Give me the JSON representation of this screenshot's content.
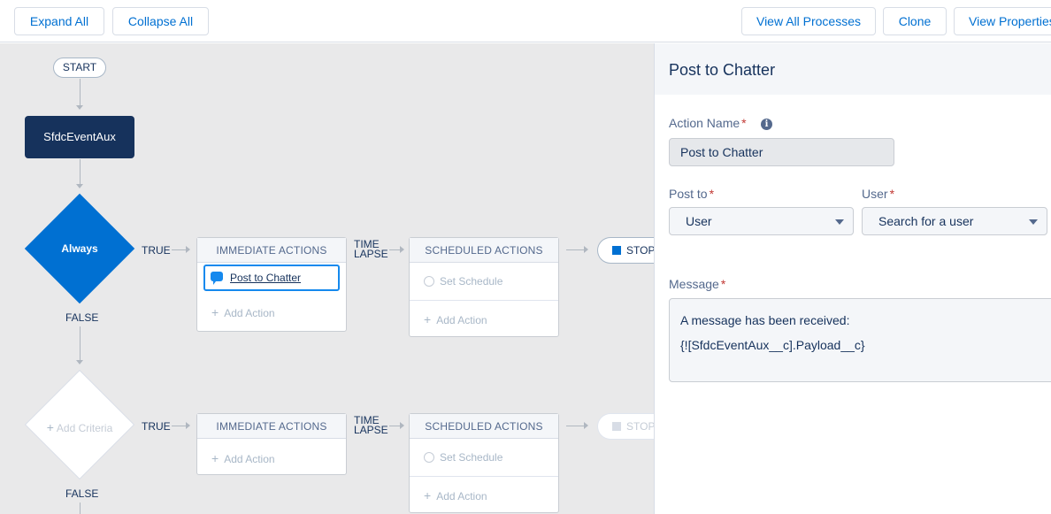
{
  "toolbar": {
    "expand_all": "Expand All",
    "collapse_all": "Collapse All",
    "view_all_processes": "View All Processes",
    "clone": "Clone",
    "view_properties": "View Properties"
  },
  "canvas": {
    "start_label": "START",
    "object_name": "SfdcEventAux",
    "criteria_1": {
      "label": "Always",
      "true_label": "TRUE",
      "false_label": "FALSE",
      "time_lapse": "TIME LAPSE",
      "immediate_header": "IMMEDIATE ACTIONS",
      "scheduled_header": "SCHEDULED ACTIONS",
      "action_item": "Post to Chatter",
      "add_action": "Add Action",
      "set_schedule": "Set Schedule",
      "stop": "STOP"
    },
    "criteria_2": {
      "label": "Add Criteria",
      "true_label": "TRUE",
      "false_label": "FALSE",
      "time_lapse": "TIME LAPSE",
      "immediate_header": "IMMEDIATE ACTIONS",
      "scheduled_header": "SCHEDULED ACTIONS",
      "add_action": "Add Action",
      "set_schedule": "Set Schedule",
      "stop": "STOP"
    }
  },
  "panel": {
    "title": "Post to Chatter",
    "action_name_label": "Action Name",
    "action_name_value": "Post to Chatter",
    "post_to_label": "Post to",
    "post_to_value": "User",
    "user_label": "User",
    "user_value": "Search for a user",
    "message_label": "Message",
    "message_line1": "A message has been received:",
    "message_line2": "{![SfdcEventAux__c].Payload__c}"
  },
  "colors": {
    "accent": "#0070d2",
    "diamond_active": "#0070d2",
    "object_node": "#16325c",
    "required": "#c23934"
  }
}
